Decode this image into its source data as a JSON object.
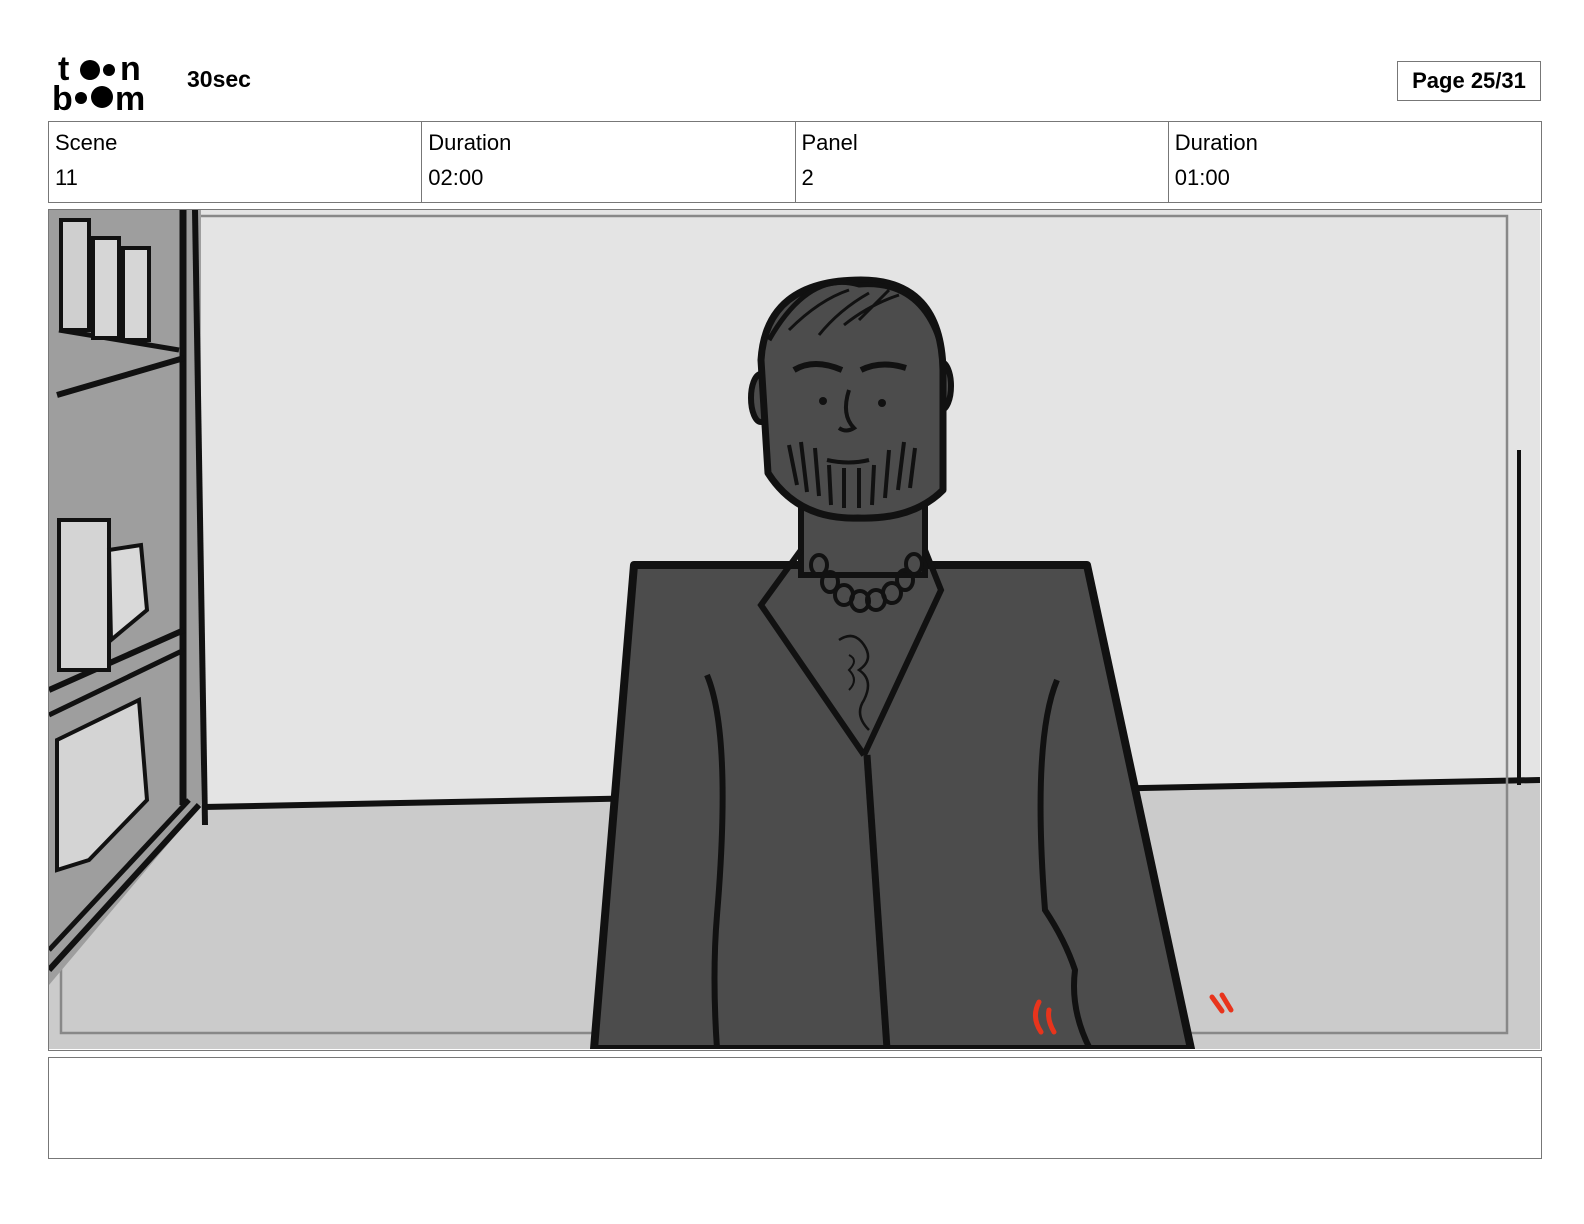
{
  "header": {
    "logo_text": "toon boom",
    "title": "30sec",
    "page": "Page 25/31"
  },
  "info": {
    "scene_label": "Scene",
    "scene_value": "11",
    "scene_duration_label": "Duration",
    "scene_duration_value": "02:00",
    "panel_label": "Panel",
    "panel_value": "2",
    "panel_duration_label": "Duration",
    "panel_duration_value": "01:00"
  },
  "notes": {
    "text": ""
  }
}
